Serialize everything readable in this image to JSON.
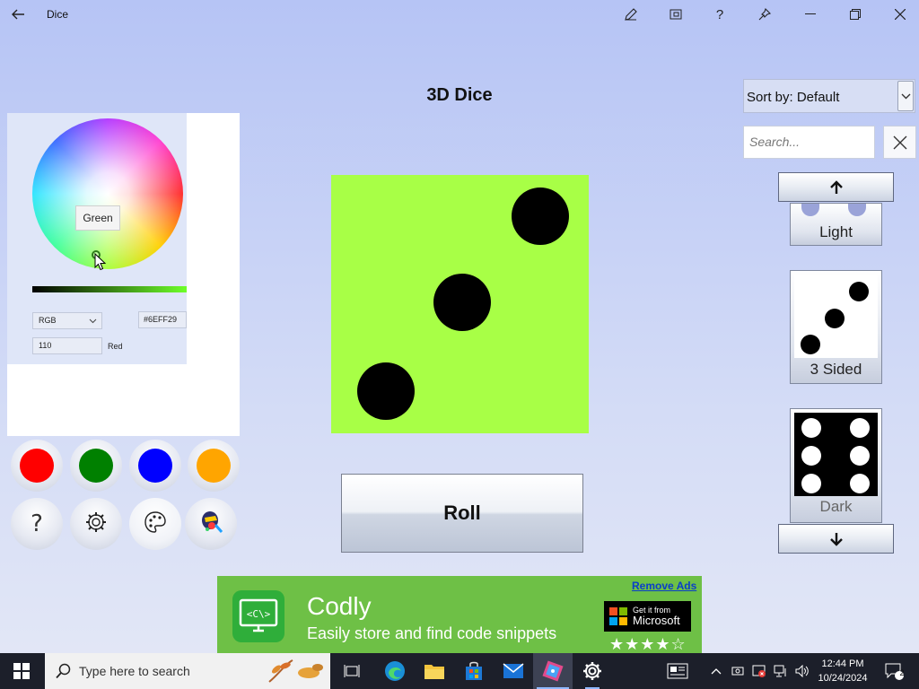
{
  "window": {
    "title": "Dice",
    "controls": [
      "edit-icon",
      "compact-overlay-icon",
      "help-icon",
      "pin-icon",
      "minimize-icon",
      "restore-icon",
      "close-icon"
    ]
  },
  "app": {
    "title": "3D Dice"
  },
  "color_picker": {
    "tooltip": "Green",
    "mode": "RGB",
    "hex": "#6EFF29",
    "channel_value": "110",
    "channel_label": "Red",
    "selected_color": "#6eff29",
    "swatches": [
      {
        "name": "red",
        "color": "#ff0000"
      },
      {
        "name": "green",
        "color": "#008000"
      },
      {
        "name": "blue",
        "color": "#0000ff"
      },
      {
        "name": "orange",
        "color": "#ffa500"
      }
    ],
    "tools": [
      "help-icon",
      "settings-gear-icon",
      "palette-icon",
      "painter-icon"
    ]
  },
  "die": {
    "face_value": 3,
    "color": "#a8ff46"
  },
  "roll_button": {
    "label": "Roll"
  },
  "right_panel": {
    "sort": {
      "label": "Sort by: Default"
    },
    "search": {
      "placeholder": "Search..."
    },
    "dice_list": [
      {
        "label": "Light"
      },
      {
        "label": "3 Sided"
      },
      {
        "label": "Dark"
      }
    ]
  },
  "ad": {
    "title": "Codly",
    "subtitle": "Easily store and find code snippets",
    "remove_link": "Remove Ads",
    "badge_line1": "Get it from",
    "badge_line2": "Microsoft",
    "stars": "★★★★☆"
  },
  "taskbar": {
    "search_placeholder": "Type here to search",
    "time": "12:44 PM",
    "date": "10/24/2024",
    "notifications": "2"
  }
}
